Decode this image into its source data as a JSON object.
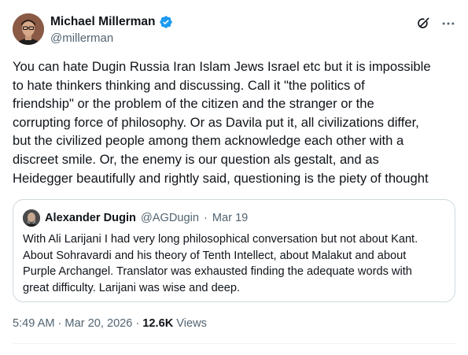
{
  "author": {
    "name": "Michael Millerman",
    "handle": "@millerman",
    "verified": true
  },
  "tweet": {
    "text": "You can hate Dugin Russia Iran Islam Jews Israel etc but it is impossible\nto hate thinkers thinking and discussing. Call it \"the politics of\nfriendship\" or the problem of the citizen and the stranger or the\ncorrupting force of philosophy. Or as Davila put it, all civilizations differ,\nbut the civilized people among them acknowledge each other with a\ndiscreet smile. Or, the enemy is our question als gestalt, and as\nHeidegger beautifully and rightly said, questioning is the piety of thought"
  },
  "quote": {
    "name": "Alexander Dugin",
    "handle": "@AGDugin",
    "separator": "·",
    "date": "Mar 19",
    "text": "With Ali Larijani I had very long philosophical conversation but not about Kant.\nAbout Sohravardi and his theory of Tenth Intellect, about Malakut and about\nPurple Archangel. Translator was exhausted finding the adequate words with\ngreat difficulty. Larijani was wise and deep."
  },
  "meta": {
    "time": "5:49 AM",
    "separator1": "·",
    "date": "Mar 20, 2026",
    "separator2": "·",
    "views_count": "12.6K",
    "views_label": "Views"
  },
  "icons": {
    "verified": "verified-badge-icon",
    "grok": "grok-icon",
    "more": "more-options-icon"
  },
  "colors": {
    "verified_blue": "#1d9bf0",
    "text_primary": "#0f1419",
    "text_secondary": "#536471",
    "border": "#cfd9de"
  }
}
